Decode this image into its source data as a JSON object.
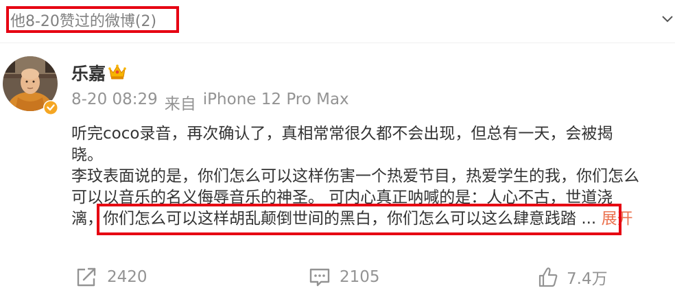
{
  "header": {
    "title": "他8-20赞过的微博(2)",
    "collapse_icon": "chevron-down-icon"
  },
  "post": {
    "author": {
      "name": "乐嘉",
      "vip_icon": "crown-icon",
      "verified_icon": "verified-badge-icon"
    },
    "time": "8-20 08:29",
    "source_prefix": "来自",
    "source": "iPhone 12 Pro Max",
    "body_lines": [
      "听完coco录音，再次确认了，真相常常很久都不会出现，但总有一天，会被揭",
      "晓。",
      "李玟表面说的是，你们怎么可以这样伤害一个热爱节目，热爱学生的我，你们怎么",
      "可以以音乐的名义侮辱音乐的神圣。 可内心真正呐喊的是：人心不古，世道浇",
      "漓，你们怎么可以这样胡乱颠倒世间的黑白，你们怎么可以这么肆意践踏"
    ],
    "ellipsis": "...",
    "expand_label": "展开"
  },
  "actions": {
    "repost_count": "2420",
    "comment_count": "2105",
    "like_count": "7.4万"
  },
  "colors": {
    "highlight_border": "#e60012",
    "expand_link": "#eb7350",
    "meta_text": "#939393",
    "body_text": "#333333",
    "verified_badge": "#f5a623"
  }
}
